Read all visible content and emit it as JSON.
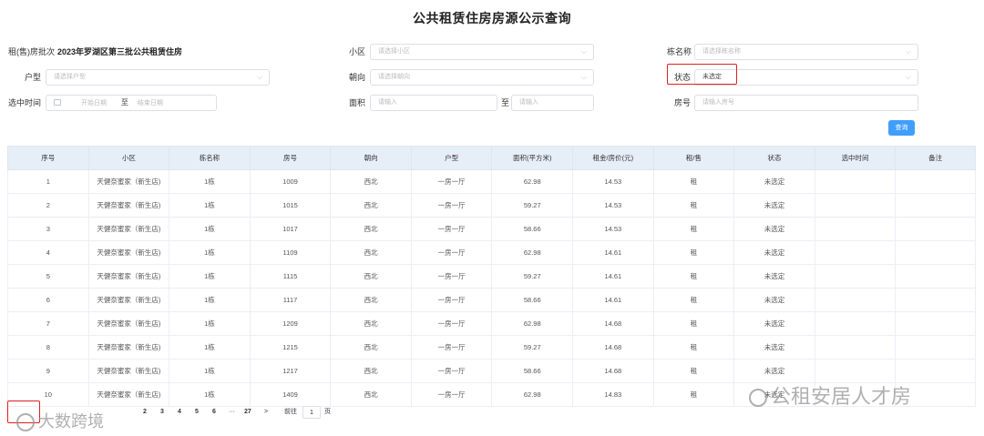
{
  "title": "公共租赁住房房源公示查询",
  "filters": {
    "batch_label": "租(售)房批次",
    "batch_value": "2023年罗湖区第三批公共租赁住房",
    "community_label": "小区",
    "community_placeholder": "请选择小区",
    "building_label": "栋名称",
    "building_placeholder": "请选择栋名称",
    "unit_type_label": "户型",
    "unit_type_placeholder": "请选择户型",
    "orientation_label": "朝向",
    "orientation_placeholder": "请选择朝向",
    "status_label": "状态",
    "status_value": "未选定",
    "selected_time_label": "选中时间",
    "start_date_placeholder": "开始日期",
    "date_separator": "至",
    "end_date_placeholder": "结束日期",
    "area_label": "面积",
    "area_min_placeholder": "请输入",
    "area_range_separator": "至",
    "area_max_placeholder": "请输入",
    "room_label": "房号",
    "room_placeholder": "请输入房号",
    "query_button": "查询"
  },
  "table": {
    "headers": [
      "序号",
      "小区",
      "栋名称",
      "房号",
      "朝向",
      "户型",
      "面积(平方米)",
      "租金/房价(元)",
      "租/售",
      "状态",
      "选中时间",
      "备注"
    ],
    "rows": [
      [
        "1",
        "天健奈蜜家（新生店)",
        "1栋",
        "1009",
        "西北",
        "一房一厅",
        "62.98",
        "14.53",
        "租",
        "未选定",
        "",
        ""
      ],
      [
        "2",
        "天健奈蜜家（新生店)",
        "1栋",
        "1015",
        "西北",
        "一房一厅",
        "59.27",
        "14.53",
        "租",
        "未选定",
        "",
        ""
      ],
      [
        "3",
        "天健奈蜜家（新生店)",
        "1栋",
        "1017",
        "西北",
        "一房一厅",
        "58.66",
        "14.53",
        "租",
        "未选定",
        "",
        ""
      ],
      [
        "4",
        "天健奈蜜家（新生店)",
        "1栋",
        "1109",
        "西北",
        "一房一厅",
        "62.98",
        "14.61",
        "租",
        "未选定",
        "",
        ""
      ],
      [
        "5",
        "天健奈蜜家（新生店)",
        "1栋",
        "1115",
        "西北",
        "一房一厅",
        "59.27",
        "14.61",
        "租",
        "未选定",
        "",
        ""
      ],
      [
        "6",
        "天健奈蜜家（新生店)",
        "1栋",
        "1117",
        "西北",
        "一房一厅",
        "58.66",
        "14.61",
        "租",
        "未选定",
        "",
        ""
      ],
      [
        "7",
        "天健奈蜜家（新生店)",
        "1栋",
        "1209",
        "西北",
        "一房一厅",
        "62.98",
        "14.68",
        "租",
        "未选定",
        "",
        ""
      ],
      [
        "8",
        "天健奈蜜家（新生店)",
        "1栋",
        "1215",
        "西北",
        "一房一厅",
        "59.27",
        "14.68",
        "租",
        "未选定",
        "",
        ""
      ],
      [
        "9",
        "天健奈蜜家（新生店)",
        "1栋",
        "1217",
        "西北",
        "一房一厅",
        "58.66",
        "14.68",
        "租",
        "未选定",
        "",
        ""
      ],
      [
        "10",
        "天健奈蜜家（新生店)",
        "1栋",
        "1409",
        "西北",
        "一房一厅",
        "62.98",
        "14.83",
        "租",
        "未选定",
        "",
        ""
      ]
    ]
  },
  "pagination": {
    "pages": [
      "2",
      "3",
      "4",
      "5",
      "6"
    ],
    "ellipsis": "···",
    "last_page": "27",
    "next": ">",
    "goto_label": "前往",
    "goto_value": "1",
    "page_unit": "页"
  },
  "watermark_right": "公租安居人才房",
  "watermark_left": "大数跨境",
  "colors": {
    "accent": "#409eff",
    "header_bg": "#e6eef8",
    "highlight": "#e02020"
  }
}
